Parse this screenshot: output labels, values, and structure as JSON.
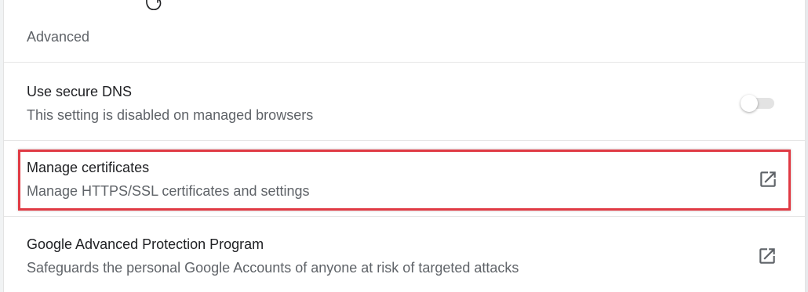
{
  "section": {
    "title": "Advanced"
  },
  "rows": [
    {
      "title": "Use secure DNS",
      "subtitle": "This setting is disabled on managed browsers",
      "control": "toggle",
      "toggle_on": false
    },
    {
      "title": "Manage certificates",
      "subtitle": "Manage HTTPS/SSL certificates and settings",
      "control": "open-in-new-icon",
      "highlighted": true
    },
    {
      "title": "Google Advanced Protection Program",
      "subtitle": "Safeguards the personal Google Accounts of anyone at risk of targeted attacks",
      "control": "open-in-new-icon"
    }
  ],
  "colors": {
    "highlight": "#e03a44",
    "title_text": "#202124",
    "secondary_text": "#5f6368",
    "icon": "#5f6368"
  }
}
